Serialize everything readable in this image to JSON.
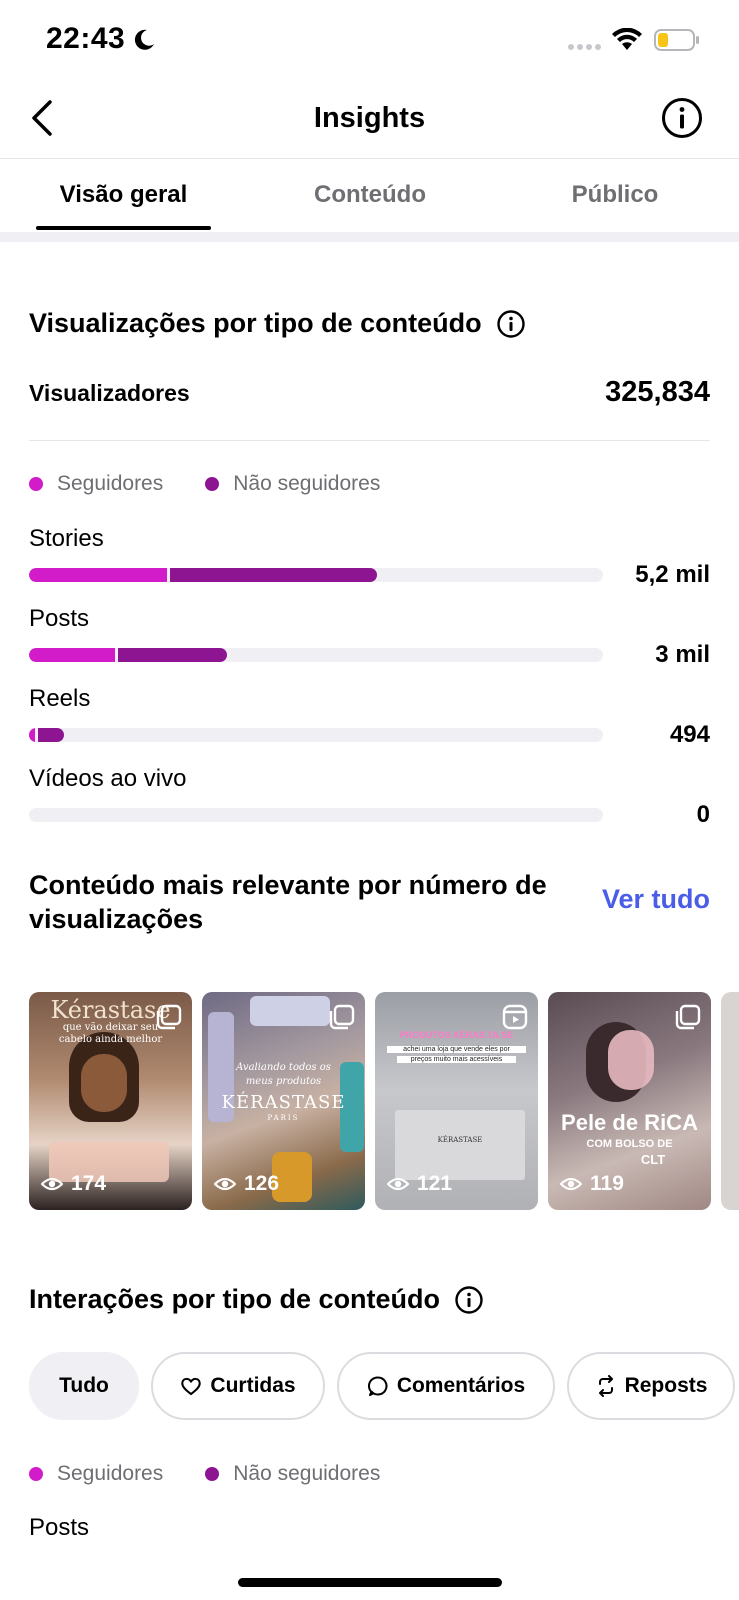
{
  "status_bar": {
    "time": "22:43"
  },
  "nav": {
    "title": "Insights"
  },
  "tabs": [
    {
      "label": "Visão geral"
    },
    {
      "label": "Conteúdo"
    },
    {
      "label": "Público"
    }
  ],
  "views_section": {
    "title": "Visualizações por tipo de conteúdo",
    "viewers_label": "Visualizadores",
    "viewers_value": "325,834",
    "legend": {
      "followers": "Seguidores",
      "non_followers": "Não seguidores"
    },
    "colors": {
      "followers": "#d21bc9",
      "non_followers": "#8e1592",
      "track": "#efeff4"
    },
    "rows": [
      {
        "label": "Stories",
        "value": "5,2 mil",
        "followers_fraction": 0.24,
        "non_followers_fraction": 0.36
      },
      {
        "label": "Posts",
        "value": "3 mil",
        "followers_fraction": 0.15,
        "non_followers_fraction": 0.19
      },
      {
        "label": "Reels",
        "value": "494",
        "followers_fraction": 0.01,
        "non_followers_fraction": 0.045
      },
      {
        "label": "Vídeos ao vivo",
        "value": "0",
        "followers_fraction": 0,
        "non_followers_fraction": 0
      }
    ]
  },
  "top_content": {
    "title": "Conteúdo mais relevante por número de visualizações",
    "see_all": "Ver tudo",
    "items": [
      {
        "views": "174",
        "type_icon": "carousel-icon",
        "caption_line1": "Kérastase",
        "caption_line2": "que vão deixar seu",
        "caption_line3": "cabelo ainda melhor"
      },
      {
        "views": "126",
        "type_icon": "carousel-icon",
        "caption_line1": "Avaliando todos os",
        "caption_line2": "meus produtos",
        "caption_line3": "KÉRASTASE",
        "caption_line4": "PARIS"
      },
      {
        "views": "121",
        "type_icon": "reel-icon",
        "caption_line1": "PRODUTOS KÉRAS.TA.SE",
        "caption_line2": "achei uma loja que vende eles por",
        "caption_line3": "preços muito mais acessíveis",
        "caption_line4": "KÉRASTASE"
      },
      {
        "views": "119",
        "type_icon": "carousel-icon",
        "caption_line1": "Pele de RiCA",
        "caption_line2": "COM BOLSO DE",
        "caption_line3": "CLT"
      }
    ]
  },
  "interactions_section": {
    "title": "Interações por tipo de conteúdo",
    "chips": [
      {
        "label": "Tudo",
        "icon": ""
      },
      {
        "label": "Curtidas",
        "icon": "heart-icon"
      },
      {
        "label": "Comentários",
        "icon": "comment-icon"
      },
      {
        "label": "Reposts",
        "icon": "repost-icon"
      }
    ],
    "legend": {
      "followers": "Seguidores",
      "non_followers": "Não seguidores"
    },
    "first_row_label": "Posts"
  }
}
